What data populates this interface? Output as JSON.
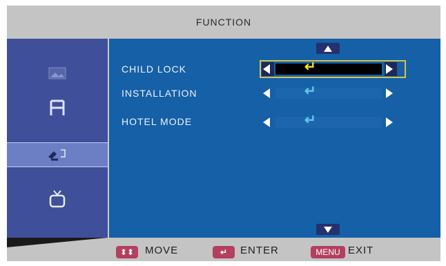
{
  "header": {
    "title": "FUNCTION"
  },
  "sidebar": {
    "items": [
      {
        "icon": "picture-icon"
      },
      {
        "icon": "installation-icon"
      },
      {
        "icon": "function-icon",
        "selected": true
      },
      {
        "icon": "tv-icon"
      }
    ]
  },
  "menu": {
    "rows": [
      {
        "label": "CHILD LOCK",
        "value_icon": "enter-icon",
        "selected": true
      },
      {
        "label": "INSTALLATION",
        "value_icon": "enter-icon",
        "selected": false
      },
      {
        "label": "HOTEL MODE",
        "value_icon": "enter-icon",
        "selected": false
      }
    ]
  },
  "footer": {
    "move_key": "⬍⬍",
    "move_label": "MOVE",
    "enter_key": "↵",
    "enter_label": "ENTER",
    "menu_key": "MENU",
    "exit_label": "EXIT"
  },
  "colors": {
    "accent_yellow": "#f4e21b",
    "enter_blue": "#5fc7e6",
    "panel_blue": "#1560a6",
    "key_red": "#b3405e"
  }
}
